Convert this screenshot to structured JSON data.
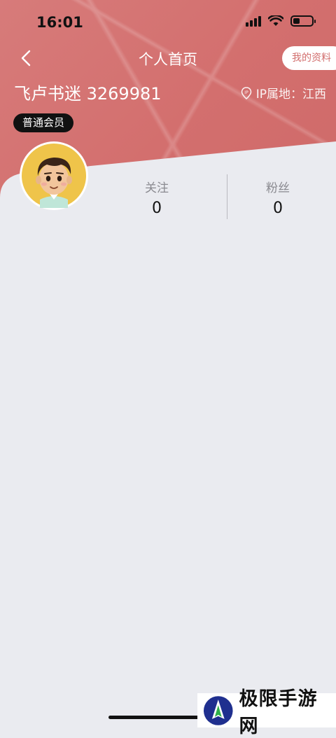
{
  "status_bar": {
    "time": "16:01"
  },
  "nav": {
    "title": "个人首页",
    "profile_button": "我的资料"
  },
  "user": {
    "name": "飞卢书迷 3269981",
    "ip_location": "IP属地：江西",
    "member_badge": "普通会员"
  },
  "stats": [
    {
      "label": "关注",
      "value": "0"
    },
    {
      "label": "粉丝",
      "value": "0"
    }
  ],
  "watermark": {
    "text": "极限手游网"
  },
  "colors": {
    "header": "#d36f6e",
    "background": "#eaebf0",
    "badge": "#111111"
  }
}
